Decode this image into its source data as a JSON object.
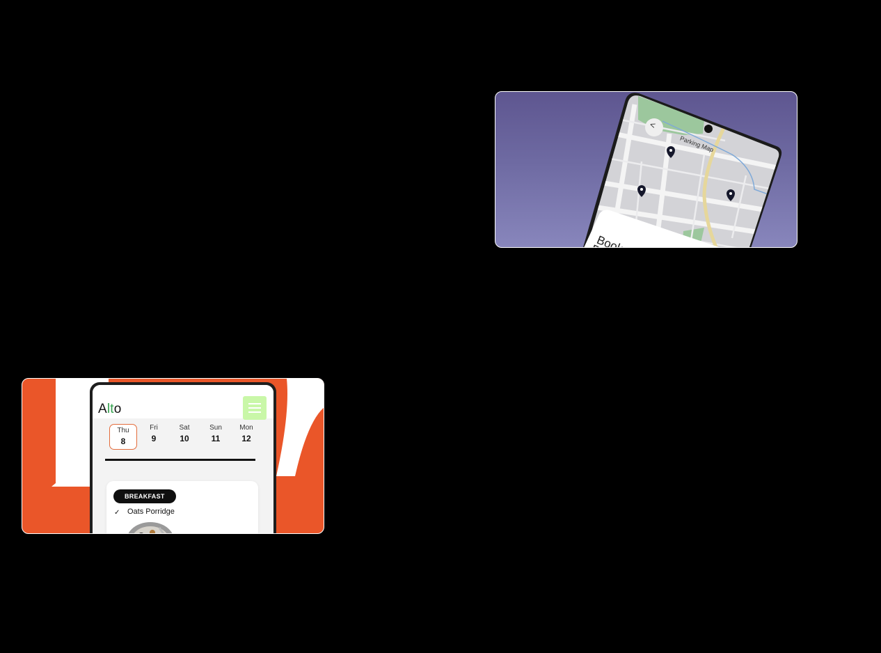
{
  "parking_card": {
    "map_title": "Parking Map",
    "back_label": "<",
    "sheet_text": "Book yo",
    "sheet_text_line2": "P",
    "icons": [
      "back-arrow-icon",
      "location-pin-icon",
      "camera-icon"
    ],
    "colors": {
      "background": "#6e6aa2",
      "road_accent": "#e6d79b",
      "park": "#8ec48f"
    }
  },
  "alto_card": {
    "logo": {
      "a": "A",
      "l": "l",
      "t": "t",
      "o": "o"
    },
    "menu_icon": "hamburger-icon",
    "days": [
      {
        "name": "Thu",
        "date": "8",
        "selected": true
      },
      {
        "name": "Fri",
        "date": "9",
        "selected": false
      },
      {
        "name": "Sat",
        "date": "10",
        "selected": false
      },
      {
        "name": "Sun",
        "date": "11",
        "selected": false
      },
      {
        "name": "Mon",
        "date": "12",
        "selected": false
      }
    ],
    "meal": {
      "tag": "BREAKFAST",
      "check": "✓",
      "name": "Oats Porridge"
    },
    "colors": {
      "background": "#ea5629",
      "accent_green": "#34a04e",
      "menu_button": "#c9f7a8",
      "selected_day": "#e36b3b"
    }
  }
}
